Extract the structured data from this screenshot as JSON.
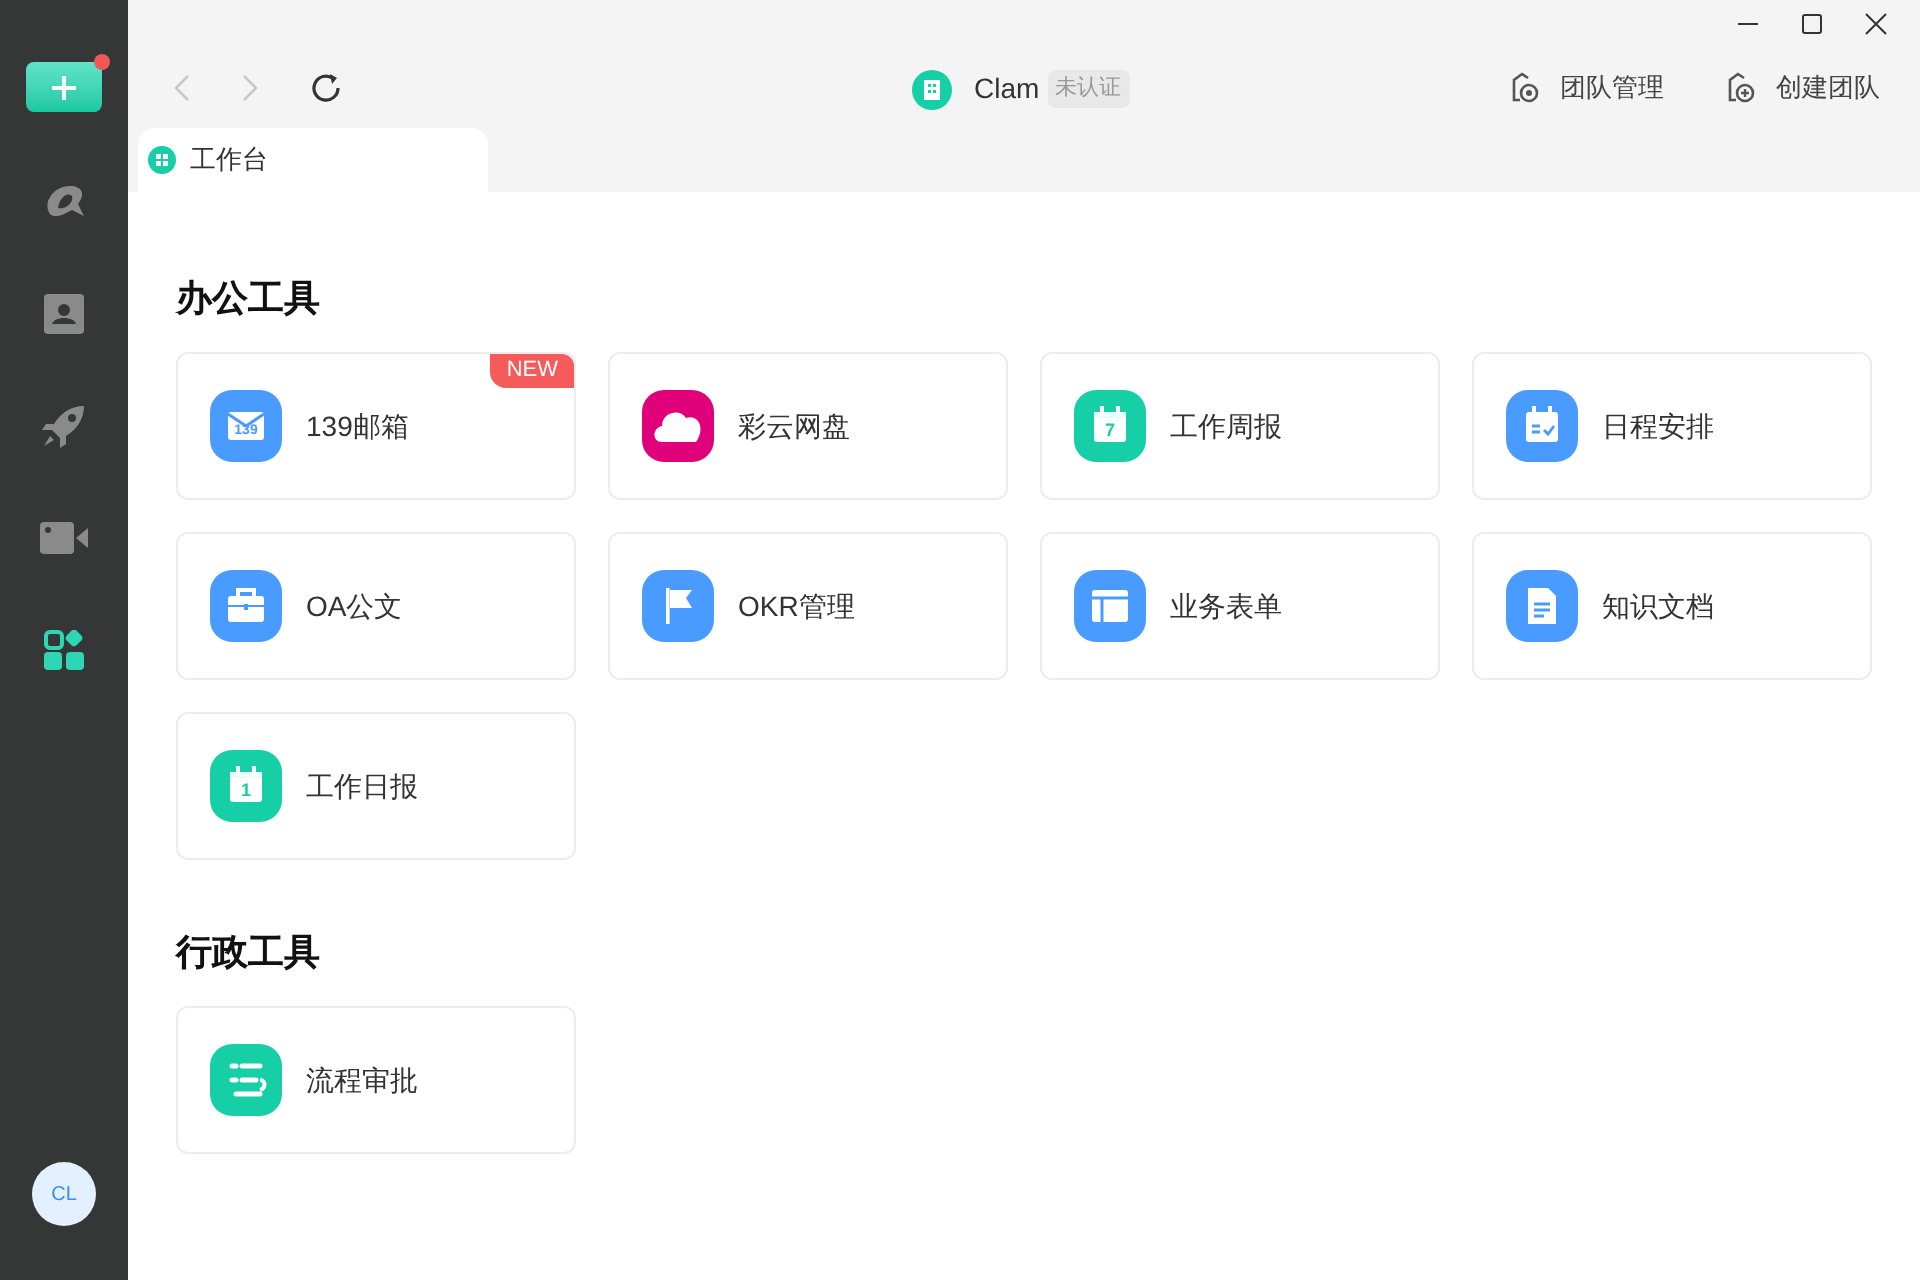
{
  "sidebar": {
    "compose_badge": true,
    "items": [
      {
        "kind": "logo",
        "selected": false
      },
      {
        "kind": "contacts",
        "selected": false
      },
      {
        "kind": "rocket",
        "selected": false
      },
      {
        "kind": "video",
        "selected": false
      },
      {
        "kind": "apps",
        "selected": true
      }
    ],
    "avatar": "CL"
  },
  "toolbar": {
    "back_disabled": true,
    "forward_disabled": true,
    "team_name": "Clam",
    "team_badge": "未认证",
    "actions": [
      {
        "kind": "manage",
        "label": "团队管理"
      },
      {
        "kind": "create",
        "label": "创建团队"
      }
    ]
  },
  "tabs": [
    {
      "label": "工作台",
      "selected": true
    }
  ],
  "sections": [
    {
      "title": "办公工具",
      "tiles": [
        {
          "label": "139邮箱",
          "kind": "mail",
          "icon_text": "139",
          "color": "#4a9bff",
          "badge": "NEW"
        },
        {
          "label": "彩云网盘",
          "kind": "cloud",
          "color": "#e0007a"
        },
        {
          "label": "工作周报",
          "kind": "calendar",
          "icon_text": "7",
          "color": "#16cfa6"
        },
        {
          "label": "日程安排",
          "kind": "schedule",
          "color": "#4a9bff"
        },
        {
          "label": "OA公文",
          "kind": "briefcase",
          "color": "#4a9bff"
        },
        {
          "label": "OKR管理",
          "kind": "flag",
          "color": "#4a9bff"
        },
        {
          "label": "业务表单",
          "kind": "table",
          "color": "#4a9bff"
        },
        {
          "label": "知识文档",
          "kind": "document",
          "color": "#4a9bff"
        },
        {
          "label": "工作日报",
          "kind": "calendar",
          "icon_text": "1",
          "color": "#16cfa6"
        }
      ]
    },
    {
      "title": "行政工具",
      "tiles": [
        {
          "label": "流程审批",
          "kind": "flow",
          "color": "#16cfa6"
        }
      ]
    }
  ]
}
